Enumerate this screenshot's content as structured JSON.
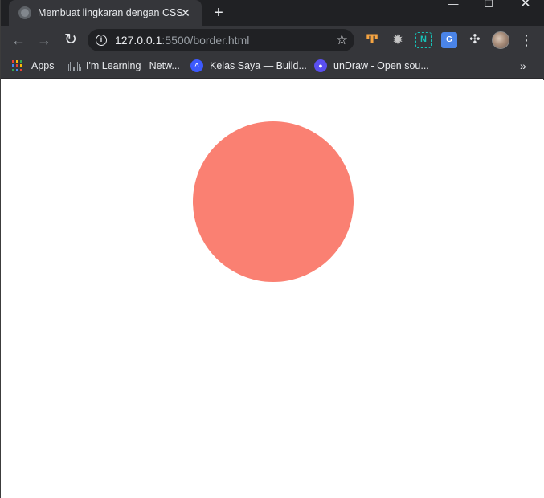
{
  "tab": {
    "title": "Membuat lingkaran dengan CSS3",
    "close_glyph": "✕"
  },
  "new_tab_glyph": "+",
  "window_controls": {
    "minimize": "—",
    "maximize": "☐",
    "close": "✕"
  },
  "toolbar": {
    "back_glyph": "←",
    "forward_glyph": "→",
    "reload_glyph": "↻",
    "url_host": "127.0.0.1",
    "url_rest": ":5500/border.html",
    "info_glyph": "i",
    "star_glyph": "☆",
    "extensions": [
      {
        "name": "extension-tool-icon",
        "glyph": "Ͳ"
      },
      {
        "name": "extension-gear-icon",
        "glyph": "✹"
      },
      {
        "name": "extension-notion-icon",
        "glyph": "N"
      },
      {
        "name": "extension-translate-icon",
        "glyph": "G"
      },
      {
        "name": "extensions-puzzle-icon",
        "glyph": "✣"
      }
    ],
    "menu_glyph": "⋮"
  },
  "bookmarks": {
    "apps_label": "Apps",
    "apps_colors": [
      "#ea4335",
      "#fbbc05",
      "#34a853",
      "#4285f4",
      "#ea4335",
      "#fbbc05",
      "#34a853",
      "#4285f4",
      "#ea4335"
    ],
    "items": [
      {
        "label": "I'm Learning | Netw..."
      },
      {
        "label": "Kelas Saya — Build..."
      },
      {
        "label": "unDraw - Open sou..."
      }
    ],
    "more_glyph": "»"
  },
  "colors": {
    "circle": "#fa8072",
    "icon_blue": "#3d5afe",
    "icon_purple": "#5a4ff0"
  }
}
